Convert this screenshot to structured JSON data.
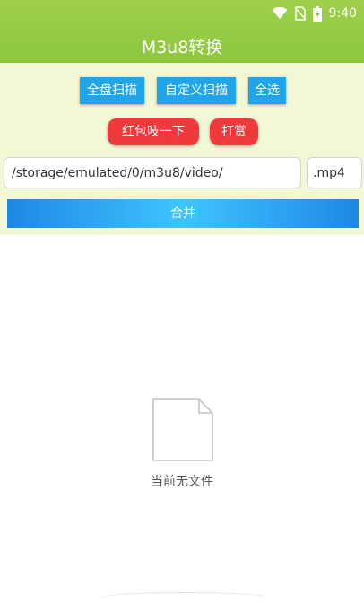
{
  "status_bar": {
    "time": "9:40",
    "icons": [
      "wifi-icon",
      "no-sim-icon",
      "battery-icon"
    ]
  },
  "app_bar": {
    "title": "M3u8转换"
  },
  "actions": {
    "scan_all": "全盘扫描",
    "custom_scan": "自定义扫描",
    "select_all": "全选",
    "red_packet": "红包吱一下",
    "tip": "打赏"
  },
  "path": {
    "value": "/storage/emulated/0/m3u8/video/"
  },
  "extension": {
    "value": ".mp4"
  },
  "merge": {
    "label": "合并"
  },
  "empty_state": {
    "text": "当前无文件",
    "icon": "document-icon"
  },
  "colors": {
    "app_bar": "#8cc63f",
    "panel": "#f2f8d6",
    "primary_button": "#20a5e8",
    "red_button": "#ee3a3a"
  }
}
